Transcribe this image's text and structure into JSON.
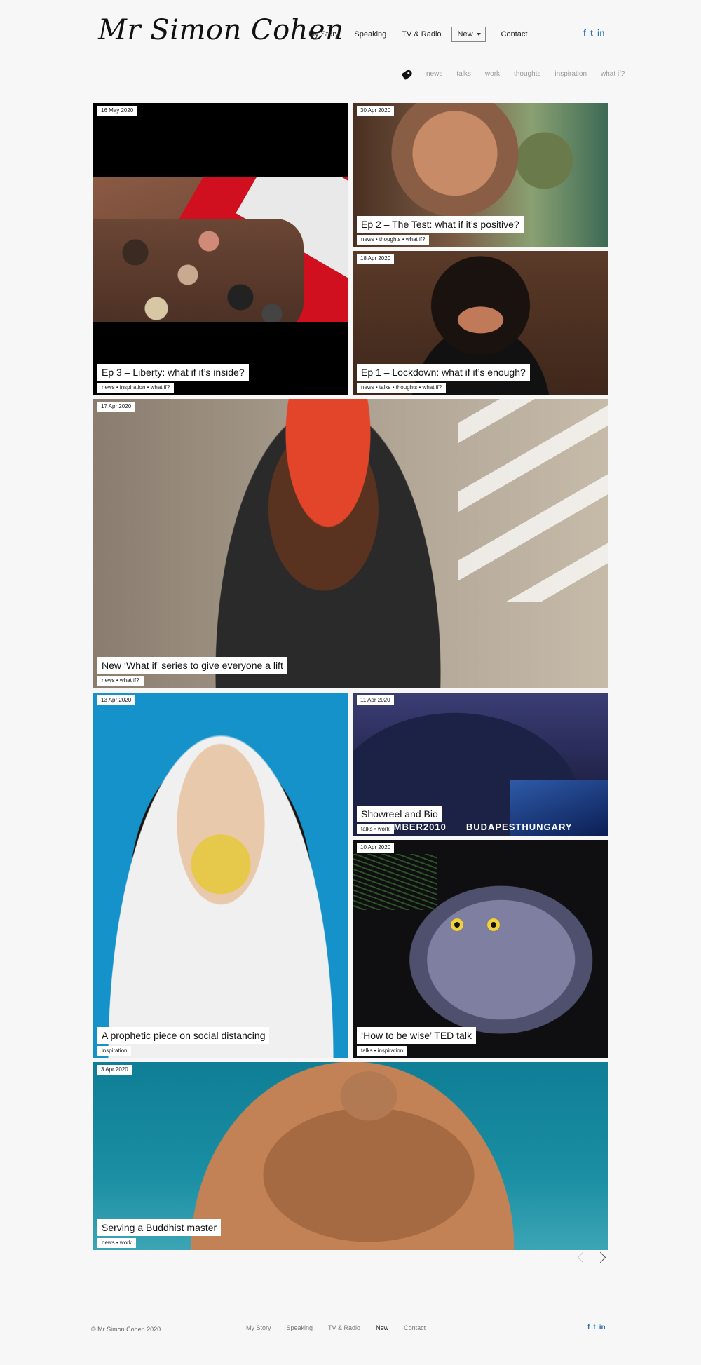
{
  "header": {
    "logo": "Mr Simon Cohen",
    "nav": [
      {
        "label": "My Story"
      },
      {
        "label": "Speaking"
      },
      {
        "label": "TV & Radio"
      },
      {
        "label": "New"
      },
      {
        "label": "Contact"
      }
    ],
    "social": [
      "f",
      "t",
      "in"
    ]
  },
  "tags": [
    "news",
    "talks",
    "work",
    "thoughts",
    "inspiration",
    "what if?"
  ],
  "posts": [
    {
      "date": "16 May 2020",
      "title": "Ep 3 – Liberty: what if it’s inside?",
      "tags": "news • inspiration • what if?"
    },
    {
      "date": "30 Apr 2020",
      "title": "Ep 2 – The Test: what if it’s positive?",
      "tags": "news • thoughts • what if?"
    },
    {
      "date": "18 Apr 2020",
      "title": "Ep 1 – Lockdown: what if it’s enough?",
      "tags": "news • talks • thoughts • what if?"
    },
    {
      "date": "17 Apr 2020",
      "title": "New ‘What if’ series to give everyone a lift",
      "tags": "news • what if?"
    },
    {
      "date": "13 Apr 2020",
      "title": "A prophetic piece on social distancing",
      "tags": "inspiration"
    },
    {
      "date": "11 Apr 2020",
      "title": "Showreel and Bio",
      "tags": "talks • work",
      "image_text_left": "TEMBER2010",
      "image_text_right": "BUDAPESTHUNGARY"
    },
    {
      "date": "10 Apr 2020",
      "title": "‘How to be wise’ TED talk",
      "tags": "talks • inspiration"
    },
    {
      "date": "3 Apr 2020",
      "title": "Serving a Buddhist master",
      "tags": "news • work"
    }
  ],
  "footer": {
    "copyright": "© Mr Simon Cohen 2020",
    "nav": [
      "My Story",
      "Speaking",
      "TV & Radio",
      "New",
      "Contact"
    ],
    "social": [
      "f",
      "t",
      "in"
    ]
  },
  "colors": {
    "background": "#f7f7f7",
    "social_blue": "#2a6fb8",
    "text": "#222222"
  }
}
